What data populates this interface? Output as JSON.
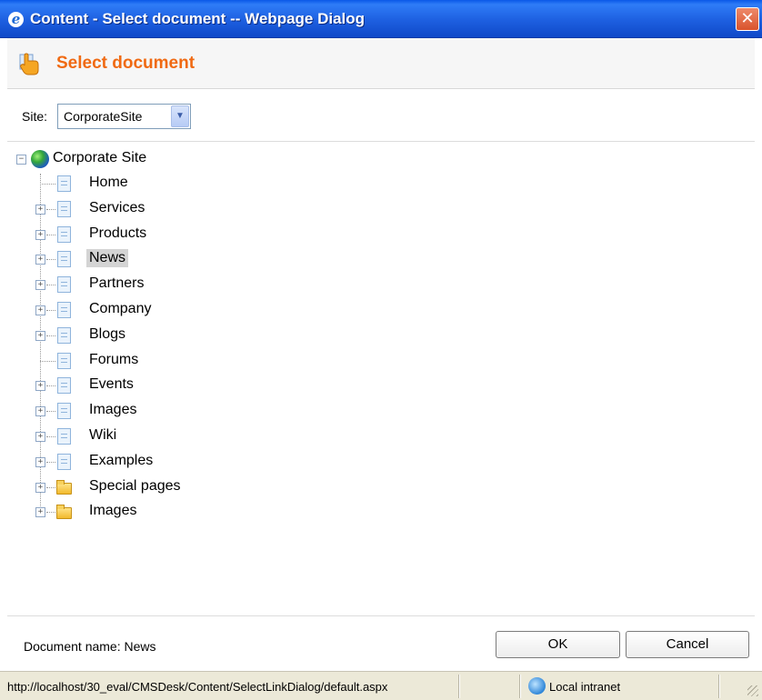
{
  "window": {
    "title": "Content - Select document -- Webpage Dialog",
    "close_label": "✕"
  },
  "header": {
    "title": "Select document",
    "accent_color": "#f06a13"
  },
  "site": {
    "label": "Site:",
    "selected": "CorporateSite"
  },
  "tree": {
    "root": {
      "label": "Corporate Site",
      "expanded": true,
      "icon": "globe-icon"
    },
    "items": [
      {
        "label": "Home",
        "expandable": false,
        "icon": "document-icon",
        "selected": false
      },
      {
        "label": "Services",
        "expandable": true,
        "icon": "document-icon",
        "selected": false
      },
      {
        "label": "Products",
        "expandable": true,
        "icon": "document-icon",
        "selected": false
      },
      {
        "label": "News",
        "expandable": true,
        "icon": "document-icon",
        "selected": true
      },
      {
        "label": "Partners",
        "expandable": true,
        "icon": "document-icon",
        "selected": false
      },
      {
        "label": "Company",
        "expandable": true,
        "icon": "document-icon",
        "selected": false
      },
      {
        "label": "Blogs",
        "expandable": true,
        "icon": "document-icon",
        "selected": false
      },
      {
        "label": "Forums",
        "expandable": false,
        "icon": "document-icon",
        "selected": false
      },
      {
        "label": "Events",
        "expandable": true,
        "icon": "document-icon",
        "selected": false
      },
      {
        "label": "Images",
        "expandable": true,
        "icon": "document-icon",
        "selected": false
      },
      {
        "label": "Wiki",
        "expandable": true,
        "icon": "document-icon",
        "selected": false
      },
      {
        "label": "Examples",
        "expandable": true,
        "icon": "document-icon",
        "selected": false
      },
      {
        "label": "Special pages",
        "expandable": true,
        "icon": "folder-icon",
        "selected": false
      },
      {
        "label": "Images",
        "expandable": true,
        "icon": "folder-icon",
        "selected": false
      }
    ]
  },
  "footer": {
    "document_name": "Document name: News",
    "ok_label": "OK",
    "cancel_label": "Cancel"
  },
  "statusbar": {
    "url": "http://localhost/30_eval/CMSDesk/Content/SelectLinkDialog/default.aspx",
    "zone": "Local intranet"
  }
}
